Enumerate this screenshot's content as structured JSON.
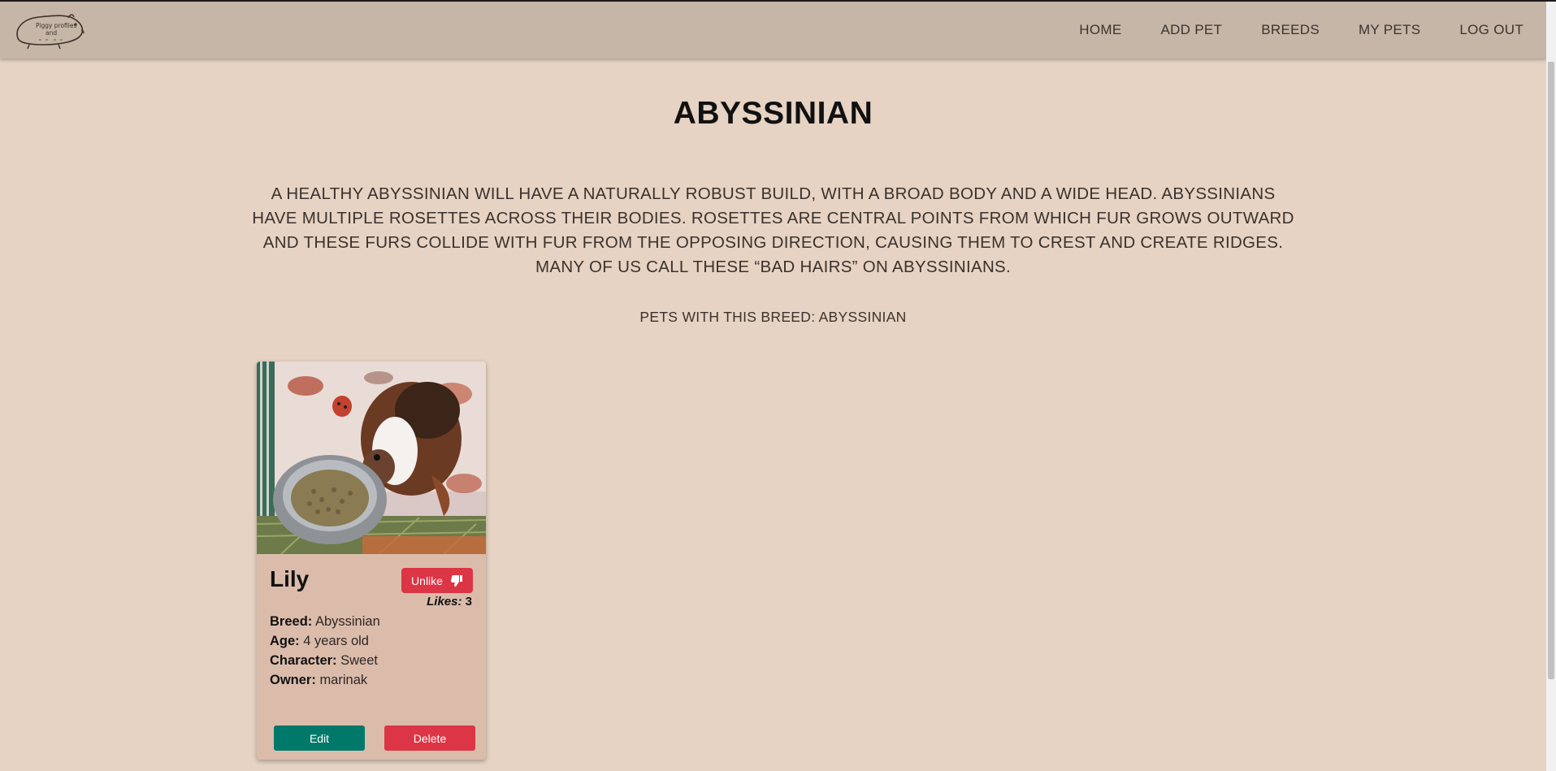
{
  "nav": {
    "logo_text_1": "Piggy profiles",
    "logo_text_2": "and",
    "links": [
      "HOME",
      "ADD PET",
      "BREEDS",
      "MY PETS",
      "LOG OUT"
    ]
  },
  "breed": {
    "title": "ABYSSINIAN",
    "description": "A HEALTHY ABYSSINIAN WILL HAVE A NATURALLY ROBUST BUILD, WITH A BROAD BODY AND A WIDE HEAD. ABYSSINIANS HAVE MULTIPLE ROSETTES ACROSS THEIR BODIES. ROSETTES ARE CENTRAL POINTS FROM WHICH FUR GROWS OUTWARD AND THESE FURS COLLIDE WITH FUR FROM THE OPPOSING DIRECTION, CAUSING THEM TO CREST AND CREATE RIDGES. MANY OF US CALL THESE “BAD HAIRS” ON ABYSSINIANS.",
    "pets_heading": "PETS WITH THIS BREED: ABYSSINIAN"
  },
  "pet_card": {
    "name": "Lily",
    "like_button": "Unlike",
    "like_icon": "thumbs-down-icon",
    "likes_label": "Likes:",
    "likes_count": "3",
    "breed_label": "Breed:",
    "breed_value": "Abyssinian",
    "age_label": "Age:",
    "age_value": "4 years old",
    "character_label": "Character:",
    "character_value": "Sweet",
    "owner_label": "Owner:",
    "owner_value": "marinak",
    "edit_button": "Edit",
    "delete_button": "Delete"
  },
  "colors": {
    "page_bg": "#e6d3c3",
    "navbar_bg": "#c6b6a7",
    "card_bg": "#dbbcab",
    "danger": "#dc3545",
    "edit": "#00796b"
  }
}
